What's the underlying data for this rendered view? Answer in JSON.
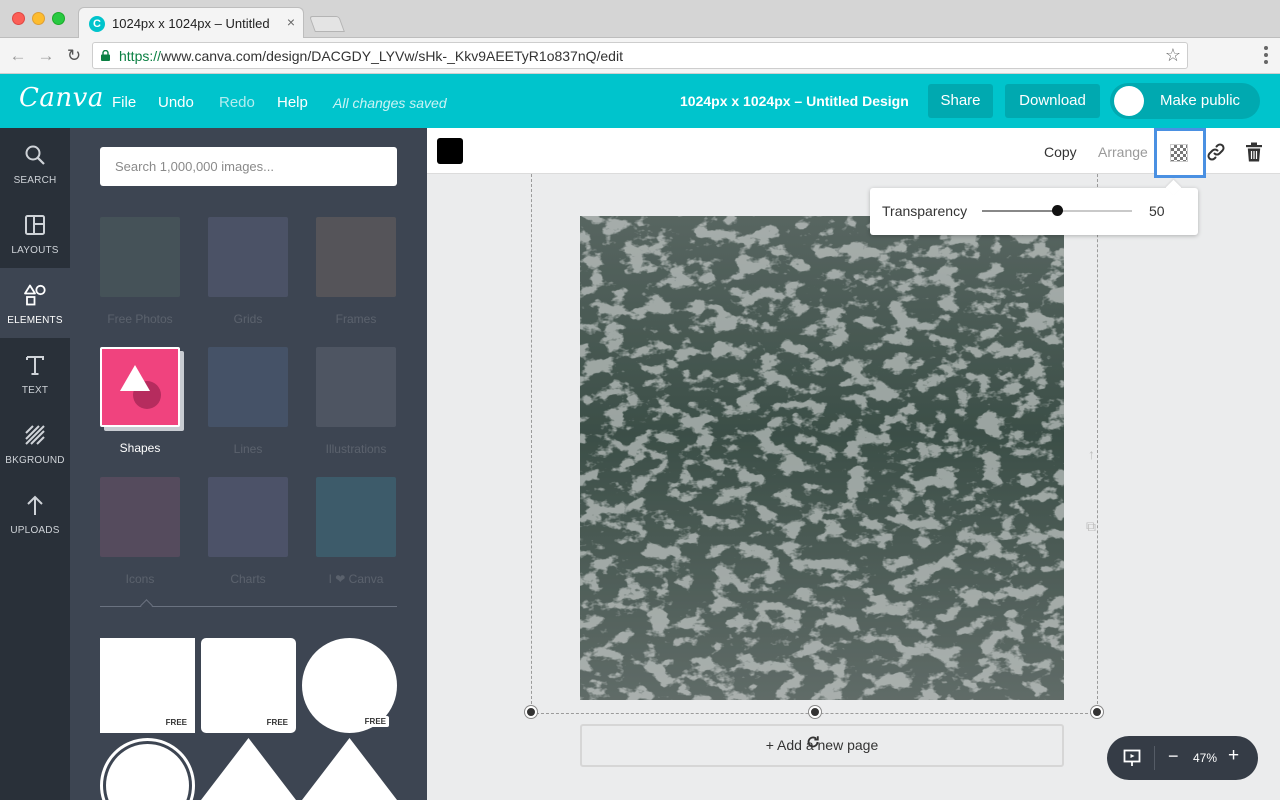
{
  "browser": {
    "tab_title": "1024px x 1024px – Untitled D",
    "tab_close": "×",
    "url_scheme": "https://",
    "url_rest": "www.canva.com/design/DACGDY_LYVw/sHk-_Kkv9AEETyR1o837nQ/edit",
    "favicon": "C"
  },
  "header": {
    "logo": "Canva",
    "menu": {
      "file": "File",
      "undo": "Undo",
      "redo": "Redo",
      "help": "Help"
    },
    "saved_status": "All changes saved",
    "design_title": "1024px x 1024px – Untitled Design",
    "share": "Share",
    "download": "Download",
    "make_public": "Make public"
  },
  "sidebar": {
    "items": [
      {
        "label": "SEARCH",
        "icon": "search-icon"
      },
      {
        "label": "LAYOUTS",
        "icon": "layouts-icon"
      },
      {
        "label": "ELEMENTS",
        "icon": "elements-icon"
      },
      {
        "label": "TEXT",
        "icon": "text-icon"
      },
      {
        "label": "BKGROUND",
        "icon": "background-icon"
      },
      {
        "label": "UPLOADS",
        "icon": "uploads-icon"
      }
    ],
    "active": "ELEMENTS"
  },
  "panel": {
    "search_placeholder": "Search 1,000,000 images...",
    "categories": [
      {
        "label": "Free Photos"
      },
      {
        "label": "Grids"
      },
      {
        "label": "Frames"
      },
      {
        "label": "Shapes"
      },
      {
        "label": "Lines"
      },
      {
        "label": "Illustrations"
      },
      {
        "label": "Icons"
      },
      {
        "label": "Charts"
      },
      {
        "label": "I ❤ Canva"
      }
    ],
    "free_badge": "FREE"
  },
  "toolbar": {
    "color": "#000000",
    "copy": "Copy",
    "arrange": "Arrange"
  },
  "transparency": {
    "label": "Transparency",
    "value": "50",
    "slider_fraction": 0.5
  },
  "canvas": {
    "add_page": "+ Add a new page"
  },
  "zoom": {
    "minus": "−",
    "level": "47%",
    "plus": "+"
  },
  "colors": {
    "brand": "#00c4cc",
    "brand_dark": "#00a9b0",
    "sidebar": "#293039",
    "panel": "#3d4552",
    "shapes_pink": "#f0437e",
    "selection": "#4a90e2"
  }
}
